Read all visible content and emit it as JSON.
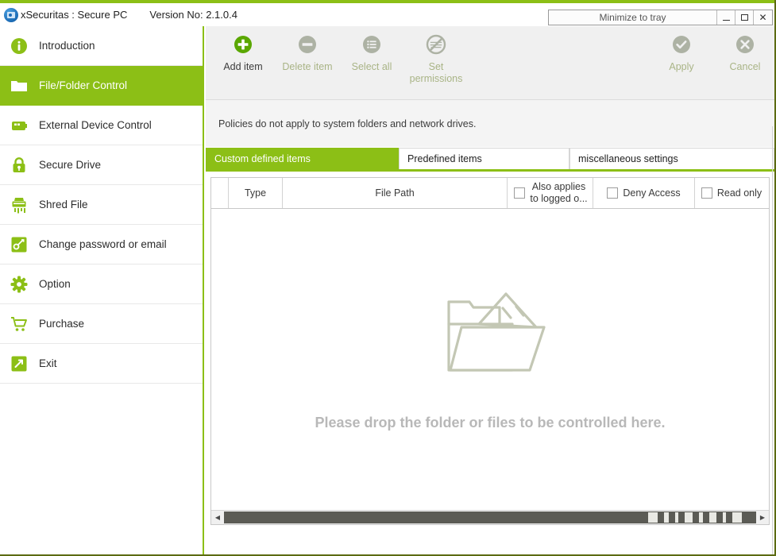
{
  "window": {
    "app_icon": "safe-box-icon",
    "title": "xSecuritas : Secure PC",
    "version": "Version No: 2.1.0.4",
    "minimize_to_tray_label": "Minimize to tray",
    "minimize_label": "–",
    "maximize_label": "□",
    "close_label": "×",
    "accent_color": "#8CBF16",
    "frame_color": "#5c6b12"
  },
  "sidebar": {
    "items": [
      {
        "label": "Introduction",
        "icon": "info-circle-icon",
        "active": false
      },
      {
        "label": "File/Folder Control",
        "icon": "folder-icon",
        "active": true
      },
      {
        "label": "External Device Control",
        "icon": "usb-drive-icon",
        "active": false
      },
      {
        "label": "Secure Drive",
        "icon": "padlock-icon",
        "active": false
      },
      {
        "label": "Shred File",
        "icon": "shredder-icon",
        "active": false
      },
      {
        "label": "Change password or email",
        "icon": "key-icon",
        "active": false
      },
      {
        "label": "Option",
        "icon": "gear-icon",
        "active": false
      },
      {
        "label": "Purchase",
        "icon": "shopping-cart-icon",
        "active": false
      },
      {
        "label": "Exit",
        "icon": "exit-arrow-icon",
        "active": false
      }
    ]
  },
  "toolbar": {
    "buttons": [
      {
        "label": "Add item",
        "icon": "plus-circle-icon",
        "enabled": true
      },
      {
        "label": "Delete item",
        "icon": "minus-circle-icon",
        "enabled": false
      },
      {
        "label": "Select all",
        "icon": "list-circle-icon",
        "enabled": false
      },
      {
        "label": "Set permissions",
        "label_line1": "Set",
        "label_line2": "permissions",
        "icon": "no-entry-circle-icon",
        "enabled": false
      }
    ],
    "apply_label": "Apply",
    "apply_icon": "check-circle-icon",
    "cancel_label": "Cancel",
    "cancel_icon": "x-circle-icon"
  },
  "info": {
    "message": "Policies do not apply to system folders and network drives."
  },
  "tabs": [
    {
      "label": "Custom defined items",
      "active": true
    },
    {
      "label": "Predefined items",
      "active": false
    },
    {
      "label": "miscellaneous settings",
      "active": false
    }
  ],
  "table": {
    "columns": [
      {
        "key": "select",
        "label": "",
        "checkbox": false
      },
      {
        "key": "type",
        "label": "Type",
        "checkbox": false
      },
      {
        "key": "file_path",
        "label": "File Path",
        "checkbox": false
      },
      {
        "key": "also_applies",
        "label_line1": "Also applies",
        "label_line2": "to  logged  o...",
        "checkbox": true,
        "checked": false
      },
      {
        "key": "deny_access",
        "label": "Deny Access",
        "checkbox": true,
        "checked": false
      },
      {
        "key": "read_only",
        "label": "Read only",
        "checkbox": true,
        "checked": false
      }
    ],
    "rows": [],
    "empty_state": {
      "icon": "open-folder-icon",
      "message": "Please drop the folder or files to be controlled here."
    }
  },
  "scrollbar": {
    "left_arrow": "◀",
    "right_arrow": "▶"
  }
}
